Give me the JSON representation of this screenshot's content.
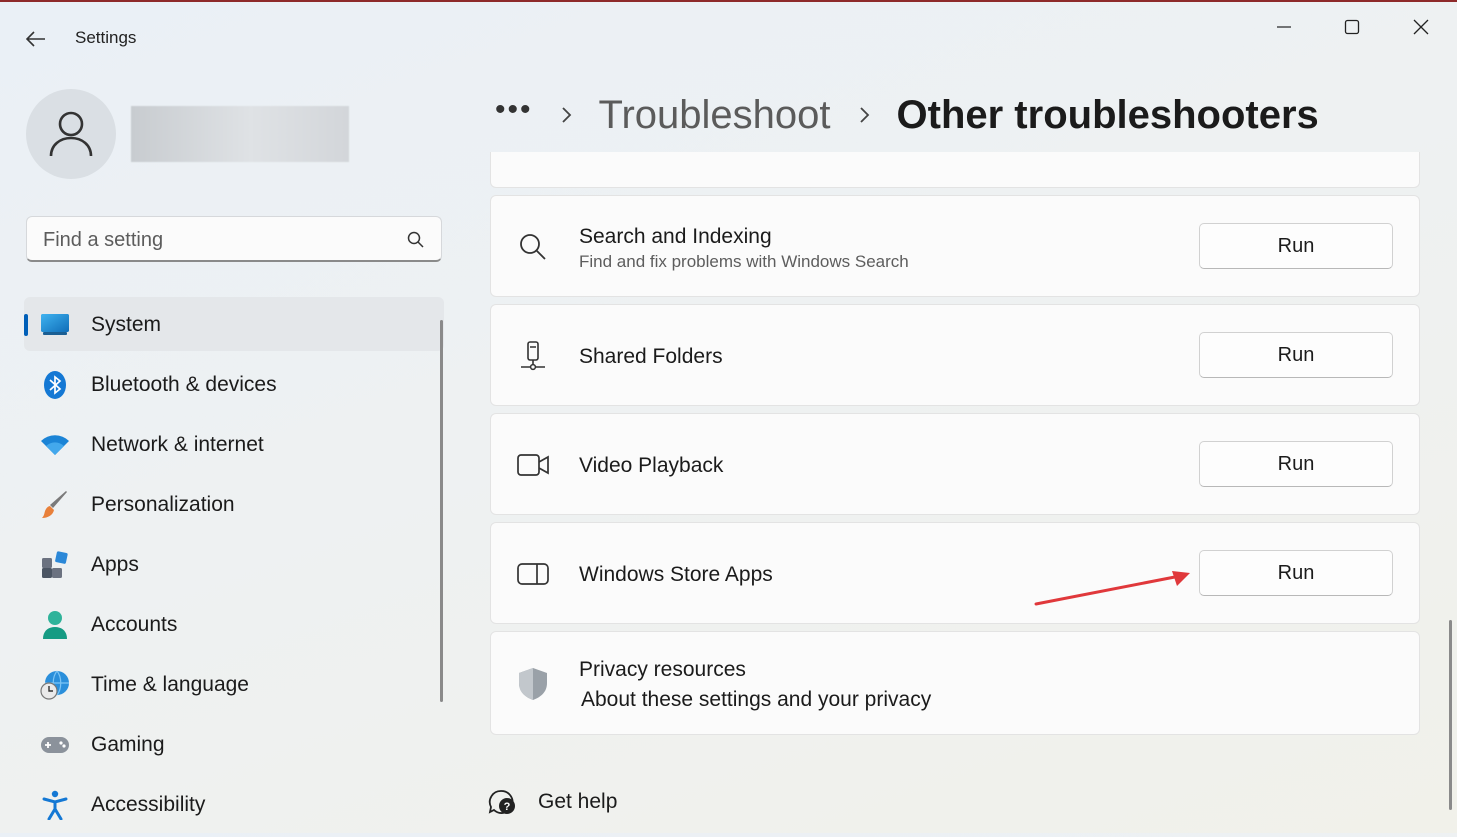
{
  "titlebar": {
    "app_title": "Settings",
    "back_icon": "arrow-left-icon",
    "minimize_icon": "minimize-icon",
    "maximize_icon": "maximize-icon",
    "close_icon": "close-icon"
  },
  "search": {
    "placeholder": "Find a setting"
  },
  "sidebar": {
    "items": [
      {
        "label": "System",
        "icon": "monitor-icon",
        "selected": true
      },
      {
        "label": "Bluetooth & devices",
        "icon": "bluetooth-icon"
      },
      {
        "label": "Network & internet",
        "icon": "wifi-icon"
      },
      {
        "label": "Personalization",
        "icon": "brush-icon"
      },
      {
        "label": "Apps",
        "icon": "apps-icon"
      },
      {
        "label": "Accounts",
        "icon": "person-icon"
      },
      {
        "label": "Time & language",
        "icon": "globe-clock-icon"
      },
      {
        "label": "Gaming",
        "icon": "gamepad-icon"
      },
      {
        "label": "Accessibility",
        "icon": "accessibility-icon"
      }
    ]
  },
  "breadcrumb": {
    "more": "•••",
    "parent": "Troubleshoot",
    "current": "Other troubleshooters"
  },
  "troubleshooters": [
    {
      "title": "Search and Indexing",
      "subtitle": "Find and fix problems with Windows Search",
      "button": "Run",
      "icon": "search-icon"
    },
    {
      "title": "Shared Folders",
      "button": "Run",
      "icon": "shared-folder-icon"
    },
    {
      "title": "Video Playback",
      "button": "Run",
      "icon": "video-camera-icon"
    },
    {
      "title": "Windows Store Apps",
      "button": "Run",
      "icon": "store-app-icon"
    }
  ],
  "privacy": {
    "title": "Privacy resources",
    "subtitle": "About these settings and your privacy",
    "icon": "shield-icon"
  },
  "get_help": {
    "label": "Get help",
    "icon": "help-chat-icon"
  },
  "colors": {
    "accent": "#005fb8",
    "annotation_arrow": "#e0383b"
  }
}
